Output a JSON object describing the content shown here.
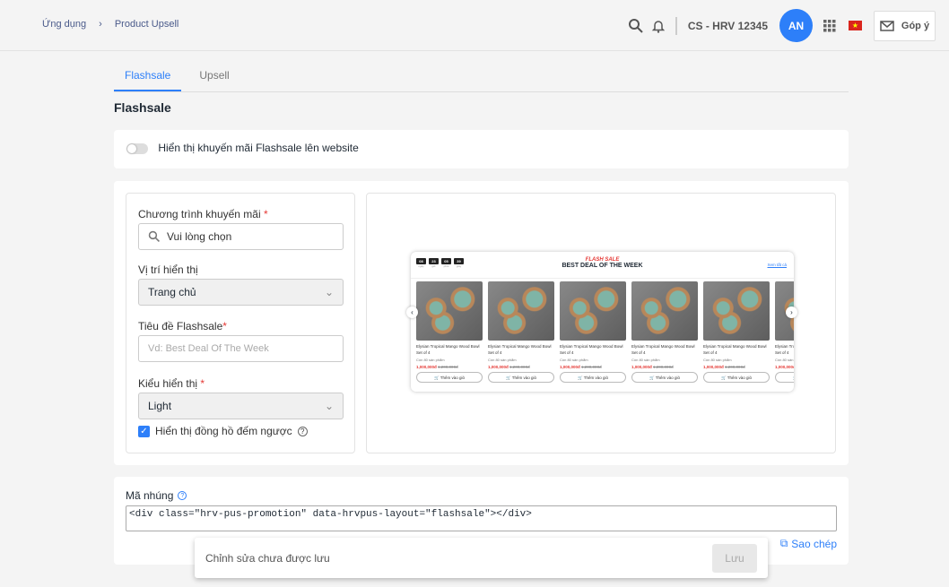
{
  "breadcrumb": [
    "Ứng dụng",
    "Product Upsell"
  ],
  "header": {
    "store": "CS - HRV 12345",
    "avatar": "AN",
    "feedback": "Góp ý"
  },
  "tabs": [
    "Flashsale",
    "Upsell"
  ],
  "title": "Flashsale",
  "toggle_label": "Hiển thị khuyến mãi Flashsale lên website",
  "form": {
    "program_label": "Chương trình khuyến mãi",
    "program_placeholder": "Vui lòng chọn",
    "position_label": "Vị trí hiển thị",
    "position_value": "Trang chủ",
    "title_label": "Tiêu đề Flashsale",
    "title_placeholder": "Vd: Best Deal Of The Week",
    "style_label": "Kiểu hiển thị",
    "style_value": "Light",
    "countdown_label": "Hiển thị đồng hồ đếm ngược"
  },
  "preview": {
    "countdown": [
      {
        "v": "08",
        "u": "ngày"
      },
      {
        "v": "23",
        "u": "giờ"
      },
      {
        "v": "05",
        "u": "phút"
      },
      {
        "v": "39",
        "u": "giây"
      }
    ],
    "flash": "FLASH SALE",
    "heading": "BEST DEAL OF THE WEEK",
    "view_all": "Xem tất cả",
    "product": {
      "name": "Elysian Tropical Mango Wood Bowl Set of 4",
      "stock": "Còn 80 sản phẩm",
      "price": "1,000,000đ",
      "old_price": "1,200,000đ",
      "button": "Thêm vào giỏ"
    }
  },
  "embed": {
    "label": "Mã nhúng",
    "code": "<div class=\"hrv-pus-promotion\" data-hrvpus-layout=\"flashsale\"></div>",
    "copy": "Sao chép"
  },
  "toast": {
    "message": "Chỉnh sửa chưa được lưu",
    "save": "Lưu"
  }
}
